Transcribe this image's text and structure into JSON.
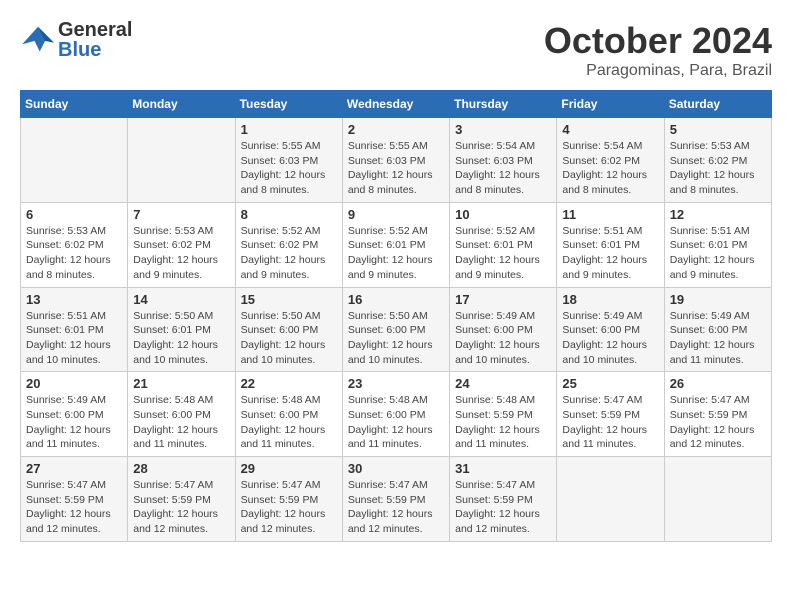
{
  "header": {
    "logo_general": "General",
    "logo_blue": "Blue",
    "month_title": "October 2024",
    "subtitle": "Paragominas, Para, Brazil"
  },
  "days_of_week": [
    "Sunday",
    "Monday",
    "Tuesday",
    "Wednesday",
    "Thursday",
    "Friday",
    "Saturday"
  ],
  "weeks": [
    [
      {
        "day": "",
        "info": ""
      },
      {
        "day": "",
        "info": ""
      },
      {
        "day": "1",
        "info": "Sunrise: 5:55 AM\nSunset: 6:03 PM\nDaylight: 12 hours and 8 minutes."
      },
      {
        "day": "2",
        "info": "Sunrise: 5:55 AM\nSunset: 6:03 PM\nDaylight: 12 hours and 8 minutes."
      },
      {
        "day": "3",
        "info": "Sunrise: 5:54 AM\nSunset: 6:03 PM\nDaylight: 12 hours and 8 minutes."
      },
      {
        "day": "4",
        "info": "Sunrise: 5:54 AM\nSunset: 6:02 PM\nDaylight: 12 hours and 8 minutes."
      },
      {
        "day": "5",
        "info": "Sunrise: 5:53 AM\nSunset: 6:02 PM\nDaylight: 12 hours and 8 minutes."
      }
    ],
    [
      {
        "day": "6",
        "info": "Sunrise: 5:53 AM\nSunset: 6:02 PM\nDaylight: 12 hours and 8 minutes."
      },
      {
        "day": "7",
        "info": "Sunrise: 5:53 AM\nSunset: 6:02 PM\nDaylight: 12 hours and 9 minutes."
      },
      {
        "day": "8",
        "info": "Sunrise: 5:52 AM\nSunset: 6:02 PM\nDaylight: 12 hours and 9 minutes."
      },
      {
        "day": "9",
        "info": "Sunrise: 5:52 AM\nSunset: 6:01 PM\nDaylight: 12 hours and 9 minutes."
      },
      {
        "day": "10",
        "info": "Sunrise: 5:52 AM\nSunset: 6:01 PM\nDaylight: 12 hours and 9 minutes."
      },
      {
        "day": "11",
        "info": "Sunrise: 5:51 AM\nSunset: 6:01 PM\nDaylight: 12 hours and 9 minutes."
      },
      {
        "day": "12",
        "info": "Sunrise: 5:51 AM\nSunset: 6:01 PM\nDaylight: 12 hours and 9 minutes."
      }
    ],
    [
      {
        "day": "13",
        "info": "Sunrise: 5:51 AM\nSunset: 6:01 PM\nDaylight: 12 hours and 10 minutes."
      },
      {
        "day": "14",
        "info": "Sunrise: 5:50 AM\nSunset: 6:01 PM\nDaylight: 12 hours and 10 minutes."
      },
      {
        "day": "15",
        "info": "Sunrise: 5:50 AM\nSunset: 6:00 PM\nDaylight: 12 hours and 10 minutes."
      },
      {
        "day": "16",
        "info": "Sunrise: 5:50 AM\nSunset: 6:00 PM\nDaylight: 12 hours and 10 minutes."
      },
      {
        "day": "17",
        "info": "Sunrise: 5:49 AM\nSunset: 6:00 PM\nDaylight: 12 hours and 10 minutes."
      },
      {
        "day": "18",
        "info": "Sunrise: 5:49 AM\nSunset: 6:00 PM\nDaylight: 12 hours and 10 minutes."
      },
      {
        "day": "19",
        "info": "Sunrise: 5:49 AM\nSunset: 6:00 PM\nDaylight: 12 hours and 11 minutes."
      }
    ],
    [
      {
        "day": "20",
        "info": "Sunrise: 5:49 AM\nSunset: 6:00 PM\nDaylight: 12 hours and 11 minutes."
      },
      {
        "day": "21",
        "info": "Sunrise: 5:48 AM\nSunset: 6:00 PM\nDaylight: 12 hours and 11 minutes."
      },
      {
        "day": "22",
        "info": "Sunrise: 5:48 AM\nSunset: 6:00 PM\nDaylight: 12 hours and 11 minutes."
      },
      {
        "day": "23",
        "info": "Sunrise: 5:48 AM\nSunset: 6:00 PM\nDaylight: 12 hours and 11 minutes."
      },
      {
        "day": "24",
        "info": "Sunrise: 5:48 AM\nSunset: 5:59 PM\nDaylight: 12 hours and 11 minutes."
      },
      {
        "day": "25",
        "info": "Sunrise: 5:47 AM\nSunset: 5:59 PM\nDaylight: 12 hours and 11 minutes."
      },
      {
        "day": "26",
        "info": "Sunrise: 5:47 AM\nSunset: 5:59 PM\nDaylight: 12 hours and 12 minutes."
      }
    ],
    [
      {
        "day": "27",
        "info": "Sunrise: 5:47 AM\nSunset: 5:59 PM\nDaylight: 12 hours and 12 minutes."
      },
      {
        "day": "28",
        "info": "Sunrise: 5:47 AM\nSunset: 5:59 PM\nDaylight: 12 hours and 12 minutes."
      },
      {
        "day": "29",
        "info": "Sunrise: 5:47 AM\nSunset: 5:59 PM\nDaylight: 12 hours and 12 minutes."
      },
      {
        "day": "30",
        "info": "Sunrise: 5:47 AM\nSunset: 5:59 PM\nDaylight: 12 hours and 12 minutes."
      },
      {
        "day": "31",
        "info": "Sunrise: 5:47 AM\nSunset: 5:59 PM\nDaylight: 12 hours and 12 minutes."
      },
      {
        "day": "",
        "info": ""
      },
      {
        "day": "",
        "info": ""
      }
    ]
  ]
}
